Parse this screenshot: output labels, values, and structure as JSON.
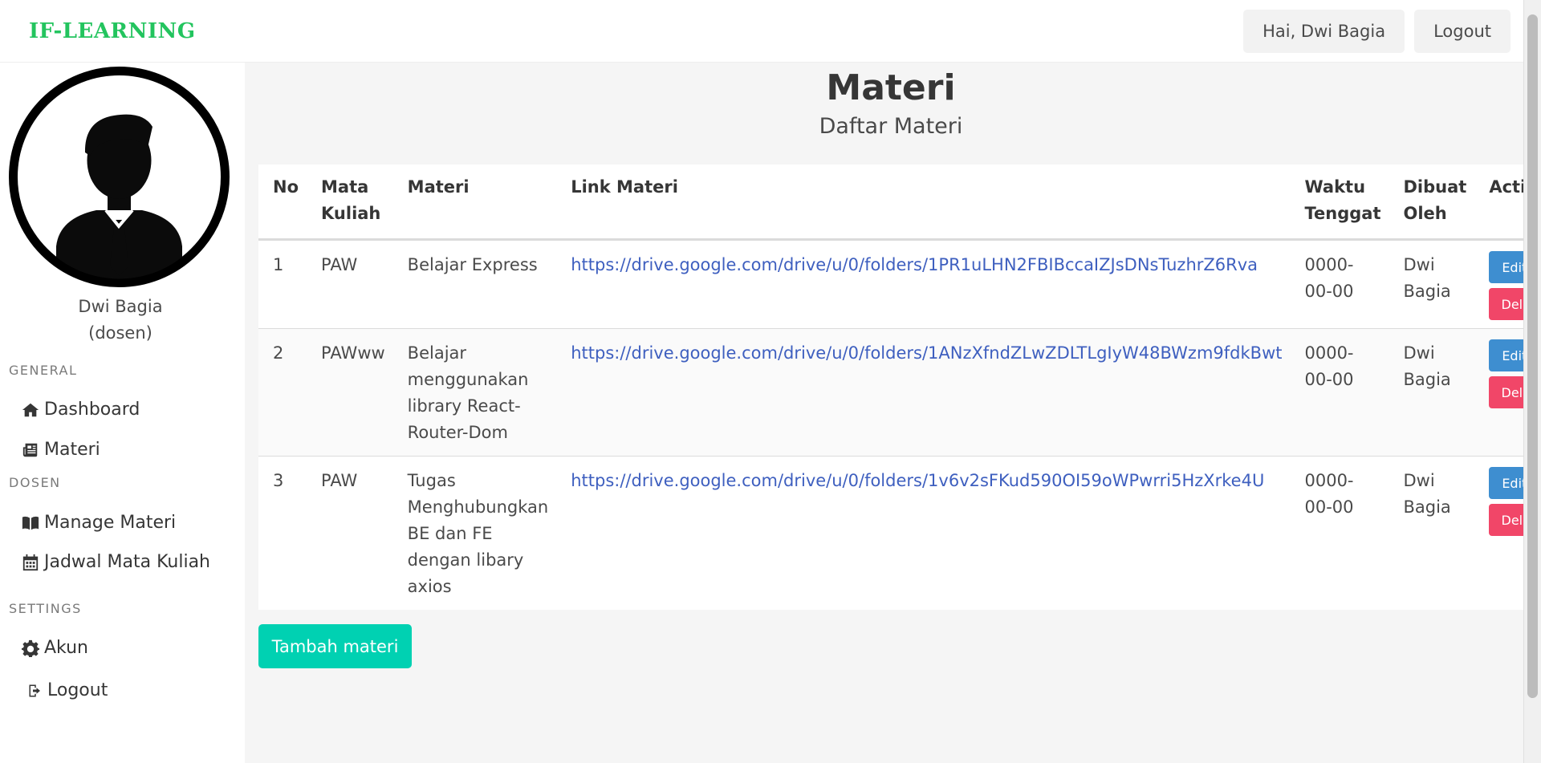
{
  "navbar": {
    "brand": "IF-LEARNING",
    "greeting": "Hai, Dwi Bagia",
    "logout": "Logout"
  },
  "sidebar": {
    "user_name": "Dwi Bagia",
    "user_role": "(dosen)",
    "sections": {
      "general": "GENERAL",
      "dosen": "DOSEN",
      "settings": "SETTINGS"
    },
    "items": {
      "dashboard": "Dashboard",
      "materi": "Materi",
      "manage_materi": "Manage Materi",
      "jadwal": "Jadwal Mata Kuliah",
      "akun": "Akun",
      "logout": "Logout"
    }
  },
  "main": {
    "title": "Materi",
    "subtitle": "Daftar Materi",
    "add_button": "Tambah materi"
  },
  "table": {
    "headers": {
      "no": "No",
      "mata_kuliah": "Mata Kuliah",
      "materi": "Materi",
      "link": "Link Materi",
      "waktu": "Waktu Tenggat",
      "dibuat": "Dibuat Oleh",
      "actions": "Actions"
    },
    "edit_label": "Edit",
    "delete_label": "Delete",
    "rows": [
      {
        "no": "1",
        "mata_kuliah": "PAW",
        "materi": "Belajar Express",
        "link": "https://drive.google.com/drive/u/0/folders/1PR1uLHN2FBIBccaIZJsDNsTuzhrZ6Rva",
        "waktu": "0000-00-00",
        "dibuat": "Dwi Bagia"
      },
      {
        "no": "2",
        "mata_kuliah": "PAWww",
        "materi": "Belajar menggunakan library React-Router-Dom",
        "link": "https://drive.google.com/drive/u/0/folders/1ANzXfndZLwZDLTLgIyW48BWzm9fdkBwt",
        "waktu": "0000-00-00",
        "dibuat": "Dwi Bagia"
      },
      {
        "no": "3",
        "mata_kuliah": "PAW",
        "materi": "Tugas Menghubungkan BE dan FE dengan libary axios",
        "link": "https://drive.google.com/drive/u/0/folders/1v6v2sFKud590OI59oWPwrri5HzXrke4U",
        "waktu": "0000-00-00",
        "dibuat": "Dwi Bagia"
      }
    ]
  },
  "colors": {
    "brand": "#23c45e",
    "link": "#3e5fbf",
    "edit": "#3e8ed0",
    "delete": "#f14668",
    "primary": "#00d1b2"
  }
}
